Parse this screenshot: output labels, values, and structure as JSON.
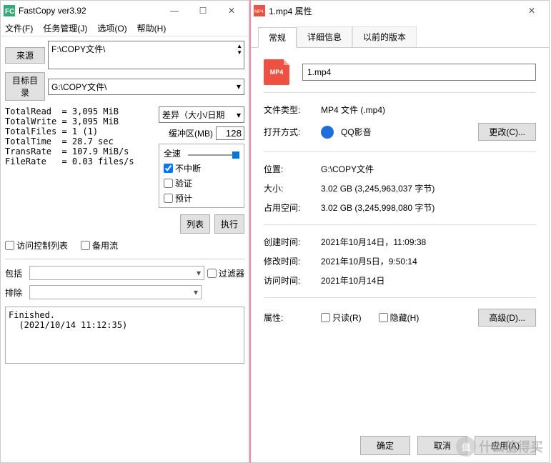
{
  "fastcopy": {
    "title": "FastCopy ver3.92",
    "menu": {
      "file": "文件(F)",
      "task": "任务管理(J)",
      "options": "选项(O)",
      "help": "帮助(H)"
    },
    "source_btn": "来源",
    "source_path": "F:\\COPY文件\\",
    "dest_label": "目标目录",
    "dest_path": "G:\\COPY文件\\",
    "stats": "TotalRead  = 3,095 MiB\nTotalWrite = 3,095 MiB\nTotalFiles = 1 (1)\nTotalTime  = 28.7 sec\nTransRate  = 107.9 MiB/s\nFileRate   = 0.03 files/s",
    "mode": "差异（大小/日期",
    "buffer_label": "缓冲区(MB)",
    "buffer_val": "128",
    "speed": "全速",
    "cb_nonstop": "不中断",
    "cb_verify": "验证",
    "cb_estimate": "预计",
    "cb_acl": "访问控制列表",
    "cb_altstream": "备用流",
    "btn_list": "列表",
    "btn_exec": "执行",
    "cb_filter": "过滤器",
    "include_label": "包括",
    "exclude_label": "排除",
    "log": "Finished.\n  (2021/10/14 11:12:35)"
  },
  "props": {
    "title": "1.mp4 属性",
    "tabs": {
      "general": "常规",
      "details": "详细信息",
      "prev": "以前的版本"
    },
    "file_icon_text": "MP4",
    "filename": "1.mp4",
    "type_label": "文件类型:",
    "type_val": "MP4 文件 (.mp4)",
    "open_label": "打开方式:",
    "open_val": "QQ影音",
    "change_btn": "更改(C)...",
    "loc_label": "位置:",
    "loc_val": "G:\\COPY文件",
    "size_label": "大小:",
    "size_val": "3.02 GB (3,245,963,037 字节)",
    "ondisk_label": "占用空间:",
    "ondisk_val": "3.02 GB (3,245,998,080 字节)",
    "created_label": "创建时间:",
    "created_val": "2021年10月14日，11:09:38",
    "modified_label": "修改时间:",
    "modified_val": "2021年10月5日，9:50:14",
    "accessed_label": "访问时间:",
    "accessed_val": "2021年10月14日",
    "attr_label": "属性:",
    "readonly": "只读(R)",
    "hidden": "隐藏(H)",
    "advanced_btn": "高级(D)...",
    "ok": "确定",
    "cancel": "取消",
    "apply": "应用(A)"
  },
  "watermark": "什么值得买"
}
